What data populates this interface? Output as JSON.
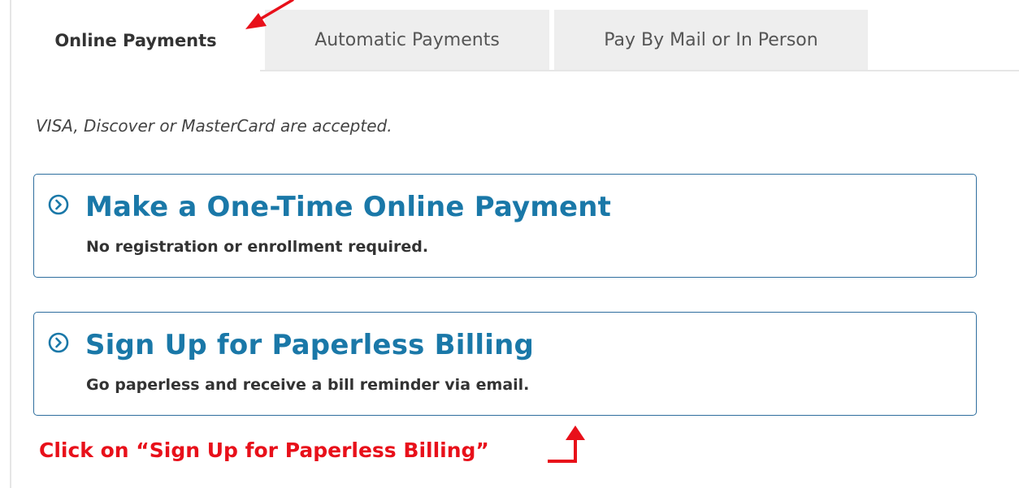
{
  "tabs": [
    {
      "label": "Online Payments",
      "active": true
    },
    {
      "label": "Automatic Payments",
      "active": false
    },
    {
      "label": "Pay By Mail or In Person",
      "active": false
    }
  ],
  "panel": {
    "accepted_cards": "VISA, Discover or MasterCard are accepted."
  },
  "options": [
    {
      "icon": "chevron-circle-right-icon",
      "title": "Make a One-Time Online Payment",
      "subtitle": "No registration or enrollment required."
    },
    {
      "icon": "chevron-circle-right-icon",
      "title": "Sign Up for Paperless Billing",
      "subtitle": "Go paperless and receive a bill reminder via email."
    }
  ],
  "annotation": {
    "text": "Click on “Sign Up for Paperless Billing”",
    "color": "#e8101a",
    "arrow_icons": [
      "red-arrow-icon",
      "red-bent-arrow-icon"
    ]
  },
  "colors": {
    "accent": "#1a78a8",
    "box_border": "#2e6e9e",
    "inactive_tab_bg": "#eeeeee"
  }
}
